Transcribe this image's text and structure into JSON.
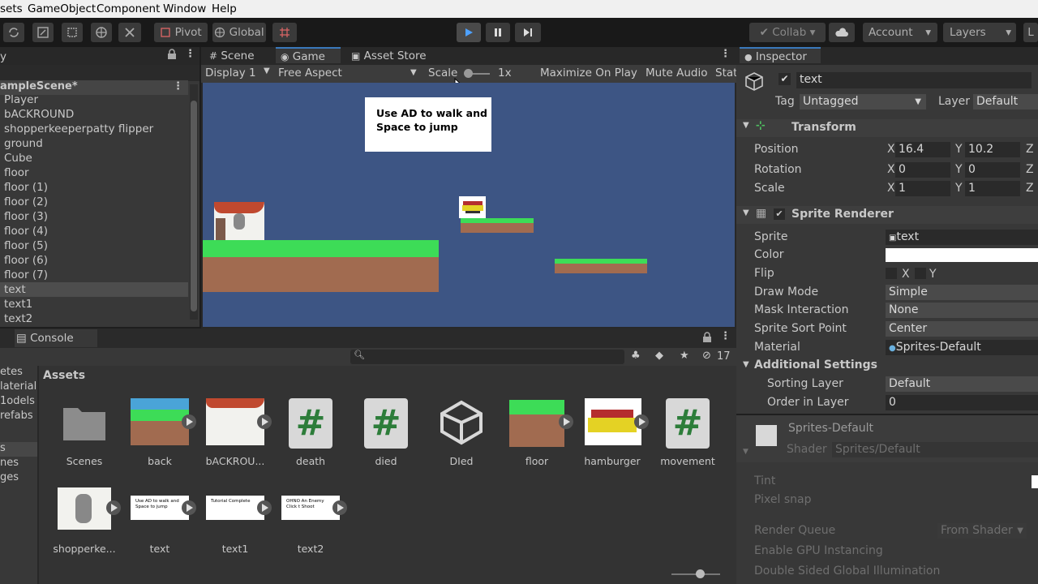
{
  "menu": [
    "sets",
    "GameObject",
    "Component",
    "Window",
    "Help"
  ],
  "toolbar": {
    "pivot": "Pivot",
    "global": "Global",
    "collab": "Collab",
    "account": "Account",
    "layers": "Layers",
    "layout": "L"
  },
  "hierarchy": {
    "tab": "y",
    "scene": "ampleScene*",
    "items": [
      "Player",
      "bACKROUND",
      "shopperkeeperpatty flipper",
      "ground",
      "Cube",
      "floor",
      "floor (1)",
      "floor (2)",
      "floor (3)",
      "floor (4)",
      "floor (5)",
      "floor (6)",
      "floor (7)",
      "text",
      "text1",
      "text2"
    ],
    "selected_index": 13
  },
  "game_view": {
    "tabs": [
      "Scene",
      "Game",
      "Asset Store"
    ],
    "display": "Display 1",
    "aspect": "Free Aspect",
    "scale_label": "Scale",
    "scale_value": "1x",
    "maximize": "Maximize On Play",
    "mute": "Mute Audio",
    "stats": "Stat",
    "instruction_line1": "Use AD to walk and",
    "instruction_line2": "Space to jump"
  },
  "console": {
    "tab": "Console",
    "hidden_count": "17"
  },
  "project": {
    "assets_heading": "Assets",
    "sidebar": [
      "etes",
      "laterial",
      "1odels",
      "refabs",
      "s",
      "nes",
      "ges"
    ],
    "assets": [
      {
        "name": "Scenes",
        "kind": "folder"
      },
      {
        "name": "back",
        "kind": "image"
      },
      {
        "name": "bACKROU...",
        "kind": "image"
      },
      {
        "name": "death",
        "kind": "script"
      },
      {
        "name": "died",
        "kind": "script"
      },
      {
        "name": "DIed",
        "kind": "unity"
      },
      {
        "name": "floor",
        "kind": "image"
      },
      {
        "name": "hamburger",
        "kind": "image"
      },
      {
        "name": "movement",
        "kind": "script"
      },
      {
        "name": "shopperke...",
        "kind": "image"
      },
      {
        "name": "text",
        "kind": "image",
        "thumb_text": "Use AD to walk and Space to jump"
      },
      {
        "name": "text1",
        "kind": "image",
        "thumb_text": "Tutorial Complete"
      },
      {
        "name": "text2",
        "kind": "image",
        "thumb_text": "OHNO An Enemy Click t Shoot"
      }
    ]
  },
  "inspector": {
    "tab": "Inspector",
    "object_name": "text",
    "tag_label": "Tag",
    "tag": "Untagged",
    "layer_label": "Layer",
    "layer": "Default",
    "transform": {
      "title": "Transform",
      "position": {
        "label": "Position",
        "x": "16.4",
        "y": "10.2"
      },
      "rotation": {
        "label": "Rotation",
        "x": "0",
        "y": "0"
      },
      "scale": {
        "label": "Scale",
        "x": "1",
        "y": "1"
      },
      "x": "X",
      "y": "Y",
      "z": "Z"
    },
    "sprite_renderer": {
      "title": "Sprite Renderer",
      "sprite_label": "Sprite",
      "sprite": "text",
      "color_label": "Color",
      "flip_label": "Flip",
      "flip_x": "X",
      "flip_y": "Y",
      "draw_mode_label": "Draw Mode",
      "draw_mode": "Simple",
      "mask_label": "Mask Interaction",
      "mask": "None",
      "sort_point_label": "Sprite Sort Point",
      "sort_point": "Center",
      "material_label": "Material",
      "material": "Sprites-Default",
      "additional": "Additional Settings",
      "sorting_layer_label": "Sorting Layer",
      "sorting_layer": "Default",
      "order_label": "Order in Layer",
      "order": "0"
    },
    "material": {
      "name": "Sprites-Default",
      "shader_label": "Shader",
      "shader": "Sprites/Default",
      "tint": "Tint",
      "pixel_snap": "Pixel snap",
      "render_queue": "Render Queue",
      "render_queue_value": "From Shader",
      "gpu": "Enable GPU Instancing",
      "double_sided": "Double Sided Global Illumination"
    }
  },
  "colors": {
    "accent": "#3a79bb",
    "canvas": "#3d5584",
    "grass": "#3ddc57",
    "dirt": "#a16b50"
  }
}
